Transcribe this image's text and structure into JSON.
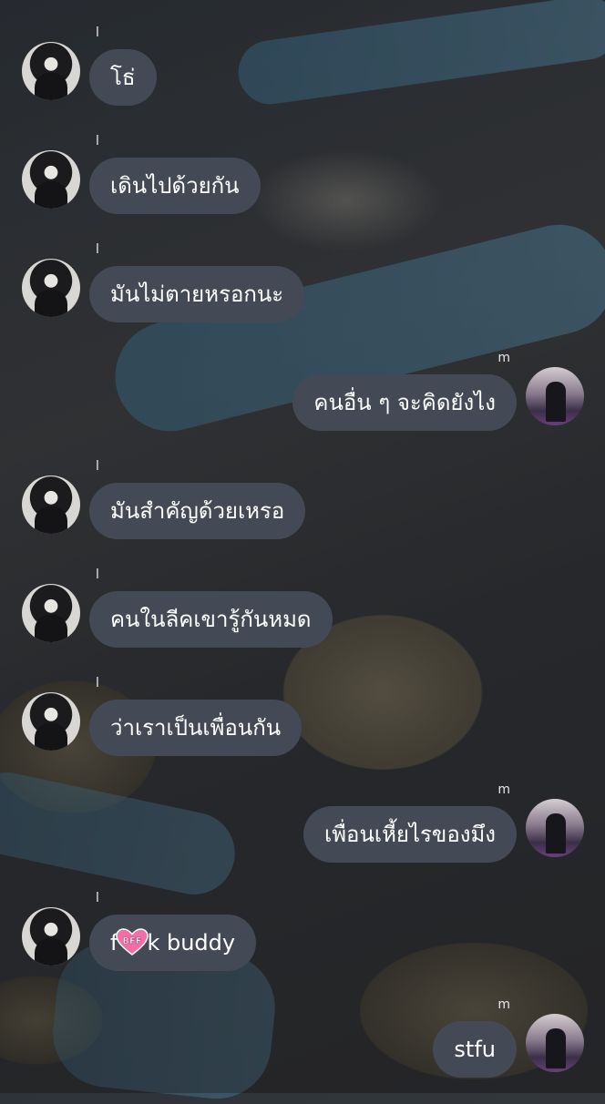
{
  "messages": [
    {
      "side": "in",
      "name": "l",
      "text": "โธ่"
    },
    {
      "side": "in",
      "name": "l",
      "text": "เดินไปด้วยกัน"
    },
    {
      "side": "in",
      "name": "l",
      "text": "มันไม่ตายหรอกนะ"
    },
    {
      "side": "out",
      "name": "m",
      "text": "คนอื่น ๆ จะคิดยังไง"
    },
    {
      "side": "in",
      "name": "l",
      "text": "มันสำคัญด้วยเหรอ"
    },
    {
      "side": "in",
      "name": "l",
      "text": "คนในลีคเขารู้กันหมด"
    },
    {
      "side": "in",
      "name": "l",
      "text": "ว่าเราเป็นเพื่อนกัน"
    },
    {
      "side": "out",
      "name": "m",
      "text": "เพื่อนเหี้ยไรของมึง"
    },
    {
      "side": "in",
      "name": "l",
      "text_before": "f",
      "sticker": "BFF",
      "text_after": "k buddy"
    },
    {
      "side": "out",
      "name": "m",
      "text": "stfu"
    }
  ],
  "colors": {
    "bubble": "#434a55",
    "bubble_text": "#ffffff",
    "sticker_heart": "#f06fa8"
  }
}
